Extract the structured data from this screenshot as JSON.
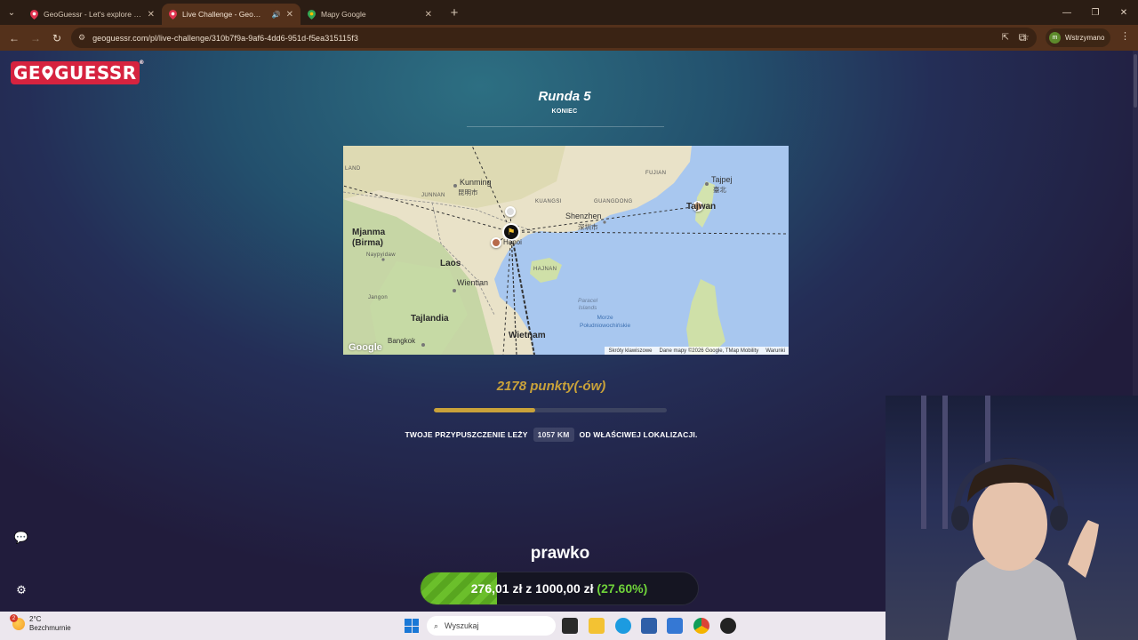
{
  "browser": {
    "tabs": [
      {
        "title": "GeoGuessr - Let's explore the w",
        "active": false
      },
      {
        "title": "Live Challenge - GeoGuessr",
        "active": true
      },
      {
        "title": "Mapy Google",
        "active": false
      }
    ],
    "url": "geoguessr.com/pl/live-challenge/310b7f9a-9af6-4dd6-951d-f5ea315115f3",
    "profile_initial": "m",
    "profile_label": "Wstrzymano"
  },
  "logo": {
    "text_left": "GE",
    "text_right": "GUESSR",
    "registered": "®"
  },
  "round": {
    "title": "Runda 5",
    "subtitle": "KONIEC"
  },
  "map": {
    "labels": {
      "kunming": "Kunming",
      "kunming_cjk": "昆明市",
      "yunnan": "JUNNAN",
      "guangxi": "KUANGSI",
      "guangdong": "GUANGDONG",
      "fujian": "FUJIAN",
      "shenzhen": "Shenzhen",
      "shenzhen_cjk": "深圳市",
      "taipei": "Tajpej",
      "taipei_cjk": "臺北",
      "taiwan": "Tajwan",
      "myanmar": "Mjanma\n(Birma)",
      "naypyidaw": "Naypyidaw",
      "laos": "Laos",
      "vientiane": "Wientian",
      "hainan": "HAJNAN",
      "hanoi": "Hanoi",
      "thailand": "Tajlandia",
      "bangkok": "Bangkok",
      "vietnam": "Wietnam",
      "paracel": "Paracel\nIslands",
      "sea": "Morze\nPołudniowochińskie",
      "land_edge": "LAND",
      "yangon": "Jangon"
    },
    "footer": [
      "Skróty klawiszowe",
      "Dane mapy ©2026 Google, TMap Mobility",
      "Warunki"
    ],
    "google": "Google"
  },
  "result": {
    "points": "2178 punkty(-ów)",
    "score_fraction": 0.4356,
    "distance_prefix": "TWOJE PRZYPUSZCZENIE LEŻY",
    "distance_value": "1057 KM",
    "distance_suffix": "OD WŁAŚCIWEJ LOKALIZACJI."
  },
  "donation": {
    "title": "prawko",
    "amount": "276,01 zł",
    "connector": "z",
    "goal": "1000,00 zł",
    "percent": "(27.60%)",
    "progress": 0.276
  },
  "taskbar": {
    "weather_temp": "2°C",
    "weather_desc": "Bezchmurnie",
    "weather_badge": "2",
    "search_placeholder": "Wyszukaj"
  },
  "colors": {
    "accent_gold": "#c9a23a",
    "brand_red": "#d6233f",
    "donate_green": "#6bbf2b"
  }
}
